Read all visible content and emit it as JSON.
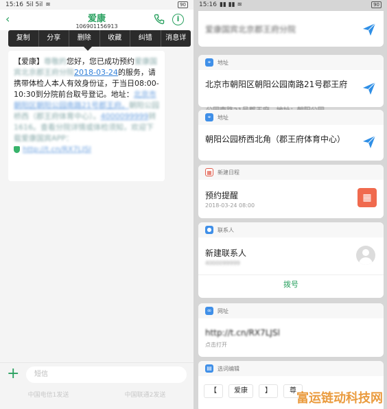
{
  "left": {
    "status_time": "15:16",
    "status_signal": "5il 5il",
    "battery": "90",
    "contact_name": "爱康",
    "contact_number": "106901156913",
    "context_menu": [
      "复制",
      "分享",
      "删除",
      "收藏",
      "纠错",
      "消息详"
    ],
    "message": {
      "p1": "【爱康】",
      "p1_blur": "尊敬的",
      "p2": "您好，您已成功预约",
      "p2_blur": "爱康国宾北京郡王府分院",
      "p3": "分院",
      "date_link": "2018-03-24",
      "p4": "的服务，请携带体检人本人有效身份证，于当日08:00-10:30到分院前台取号登记。地址：",
      "addr_blur": "北京市朝阳区朝阳公园南路21号郡王府。",
      "p5_blur": "朝阳公园桥西（郡王府体育中心）。",
      "phone_blur": "4000099999",
      "p6_blur": "转1616。查看分院详情或体检须知，欢迎下载爱康国宾APP：",
      "url_blur": "http://t.cn/RX7LJSl"
    },
    "input_placeholder": "短信",
    "sim1": "中国电信1发送",
    "sim2": "中国联通2发送"
  },
  "right": {
    "status_time": "15:16",
    "battery": "90",
    "cards": {
      "first": {
        "title_blur": "爱康国宾北京郡王府分院"
      },
      "address1": {
        "header": "地址",
        "title": "北京市朝阳区朝阳公园南路21号郡王府"
      },
      "address2": {
        "header": "地址",
        "overlap": "公园南路21号郡王府。地址：朝阳公园",
        "title": "朝阳公园桥西北角（郡王府体育中心）"
      },
      "calendar": {
        "header": "新建日程",
        "title": "预约提醒",
        "sub": "2018-03-24 08:00"
      },
      "contact": {
        "header": "联系人",
        "title": "新建联系人",
        "sub_blur": "4000099999",
        "action": "拨号"
      },
      "web": {
        "header": "网址",
        "title": "http://t.cn/RX7LJSl",
        "sub": "点击打开"
      },
      "words": {
        "header": "选词编辑",
        "chips": [
          "【",
          "爱康",
          "】",
          "尊"
        ]
      }
    },
    "watermark": "富运链动科技网",
    "colors": {
      "accent": "#2aa160",
      "link": "#2f7fd8",
      "send": "#2f8fe6"
    }
  }
}
